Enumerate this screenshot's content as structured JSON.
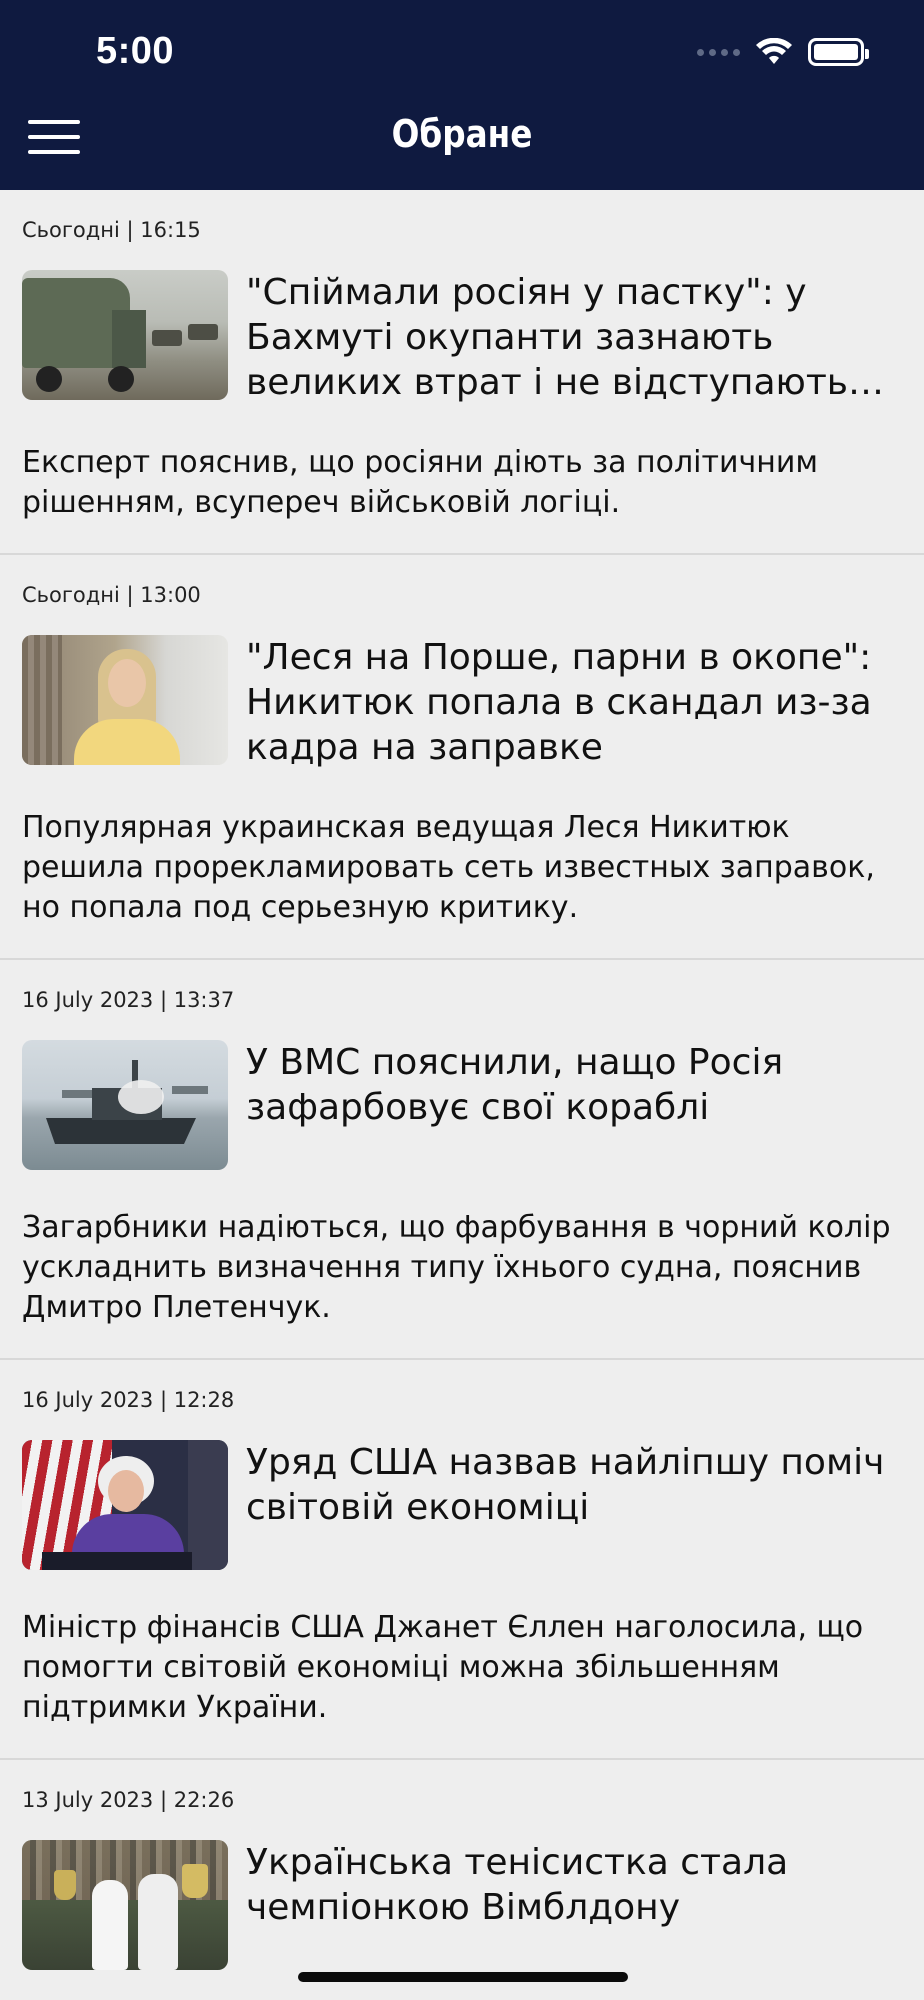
{
  "status_bar": {
    "time": "5:00",
    "icons": [
      "signal-dots-icon",
      "wifi-icon",
      "battery-icon"
    ]
  },
  "header": {
    "title": "Обране",
    "menu_icon": "hamburger-menu-icon",
    "background": "#0f1a40"
  },
  "articles": [
    {
      "meta": "Сьогодні | 16:15",
      "headline": "\"Спіймали росіян у пастку\": у Бахмуті окупанти зазнають великих втрат і не відступають всупереч військовій логіці",
      "summary": "Експерт пояснив, що росіяни діють за політичним рішенням, всупереч військовій логіці.",
      "thumbnail": "military-truck-photo"
    },
    {
      "meta": "Сьогодні | 13:00",
      "headline": "\"Леся на Порше, парни в окопе\": Никитюк попала в скандал из-за кадра на заправке",
      "summary": "Популярная украинская ведущая Леся Никитюк решила прорекламировать сеть известных заправок, но попала под серьезную критику.",
      "thumbnail": "woman-portrait-photo"
    },
    {
      "meta": "16 July 2023 | 13:37",
      "headline": "У ВМС пояснили, нащо Росія зафарбовує свої кораблі",
      "summary": "Загарбники надіються, що фарбування в чорний колір ускладнить визначення типу їхнього судна, пояснив Дмитро Плетенчук.",
      "thumbnail": "warship-photo"
    },
    {
      "meta": "16 July 2023 | 12:28",
      "headline": "Уряд США назвав найліпшу поміч світовій економіці",
      "summary": "Міністр фінансів США Джанет Єллен наголосила, що помогти світовій економіці можна збільшенням підтримки України.",
      "thumbnail": "speaker-at-podium-photo"
    },
    {
      "meta": "13 July 2023 | 22:26",
      "headline": "Українська тенісистка стала чемпіонкою Вімблдону",
      "summary": "",
      "thumbnail": "tennis-players-trophies-photo"
    }
  ]
}
